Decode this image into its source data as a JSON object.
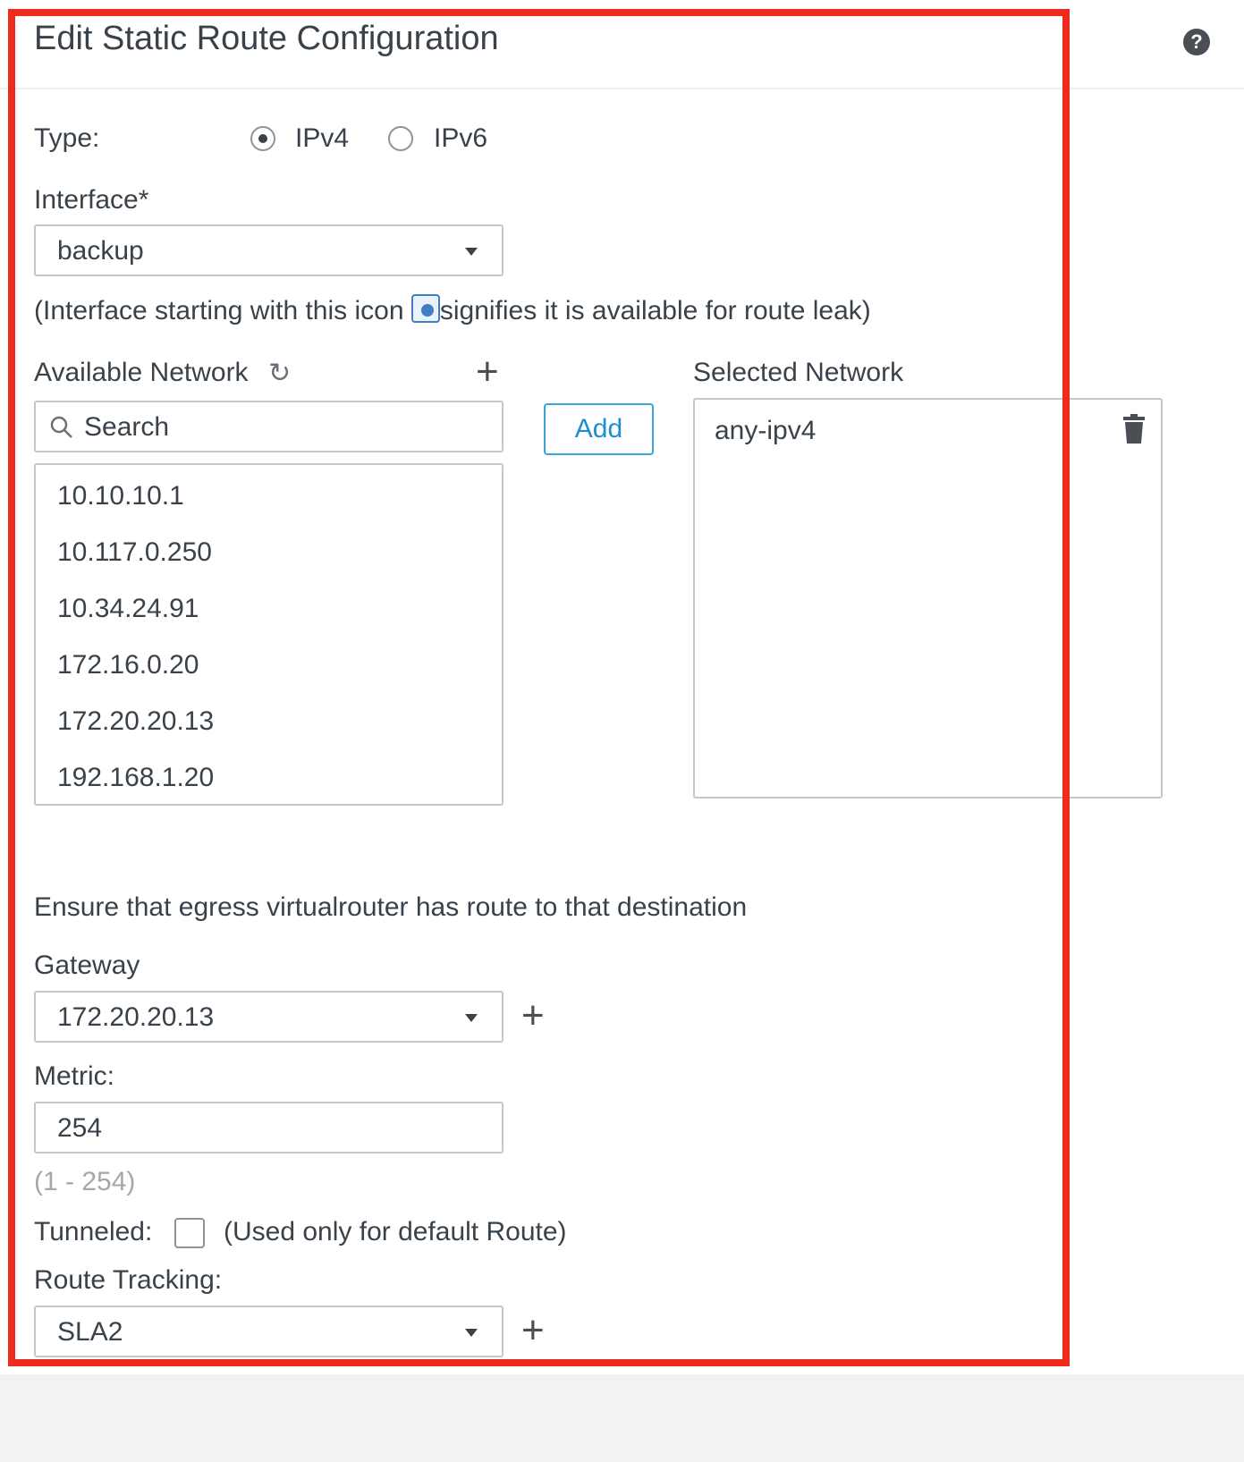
{
  "header": {
    "title": "Edit Static Route Configuration",
    "help_icon": "question-circle-icon"
  },
  "type": {
    "label": "Type:",
    "options": [
      "IPv4",
      "IPv6"
    ],
    "selected": "IPv4"
  },
  "interface": {
    "label": "Interface*",
    "value": "backup",
    "note_before": "(Interface starting with this icon ",
    "note_after": "signifies it is available for route leak)"
  },
  "available_network": {
    "label": "Available Network",
    "search_placeholder": "Search",
    "items": [
      "10.10.10.1",
      "10.117.0.250",
      "10.34.24.91",
      "172.16.0.20",
      "172.20.20.13",
      "192.168.1.20"
    ]
  },
  "add_button": {
    "label": "Add"
  },
  "selected_network": {
    "label": "Selected Network",
    "items": [
      "any-ipv4"
    ]
  },
  "egress_note": "Ensure that egress virtualrouter has route to that destination",
  "gateway": {
    "label": "Gateway",
    "value": "172.20.20.13"
  },
  "metric": {
    "label": "Metric:",
    "value": "254",
    "range_hint": "(1 - 254)"
  },
  "tunneled": {
    "label": "Tunneled:",
    "note": "(Used only for default Route)",
    "checked": false
  },
  "route_tracking": {
    "label": "Route Tracking:",
    "value": "SLA2"
  },
  "colors": {
    "accent": "#1d8fd1",
    "highlight_frame": "#ee2a1f"
  }
}
